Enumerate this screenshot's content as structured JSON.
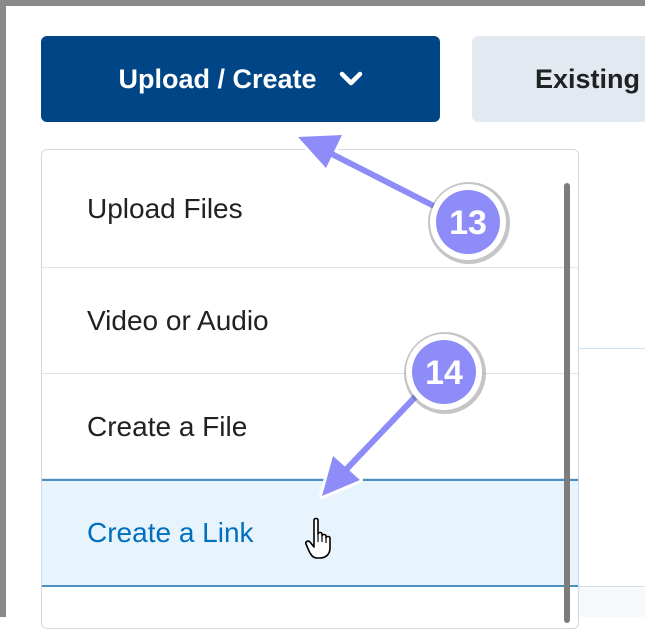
{
  "toolbar": {
    "upload_create_label": "Upload / Create",
    "existing_label": "Existing"
  },
  "menu": {
    "items": [
      {
        "label": "Upload Files"
      },
      {
        "label": "Video or Audio"
      },
      {
        "label": "Create a File"
      },
      {
        "label": "Create a Link"
      }
    ]
  },
  "annotations": {
    "step_13": "13",
    "step_14": "14"
  },
  "colors": {
    "primary_button": "#004687",
    "secondary_button": "#e3e9f1",
    "highlight_row": "#e7f4fd",
    "highlight_text": "#006fbf",
    "annotation_fill": "#8e8cf8"
  }
}
